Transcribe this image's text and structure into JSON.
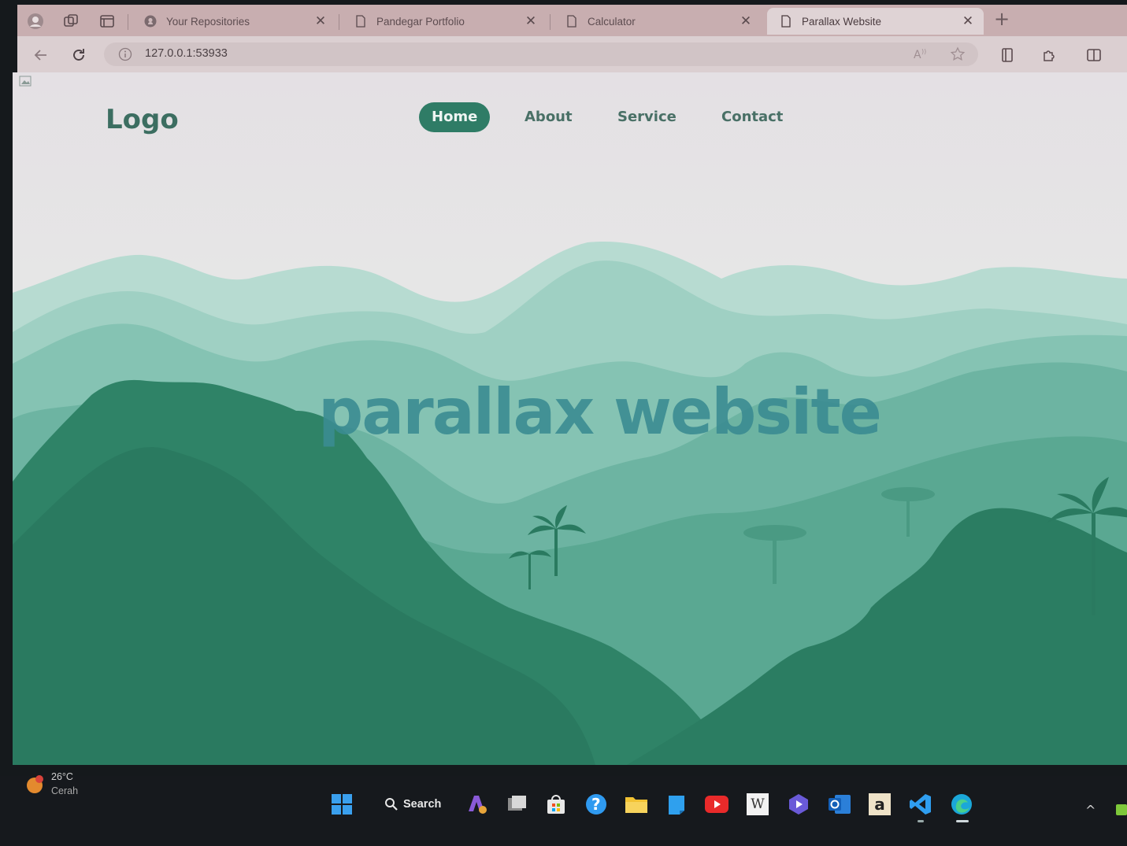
{
  "browser": {
    "tabs": [
      {
        "title": "Your Repositories",
        "icon": "github-icon",
        "active": false
      },
      {
        "title": "Pandegar Portfolio",
        "icon": "page-icon",
        "active": false
      },
      {
        "title": "Calculator",
        "icon": "page-icon",
        "active": false
      },
      {
        "title": "Parallax Website",
        "icon": "page-icon",
        "active": true
      }
    ],
    "close_glyph": "✕",
    "new_tab_glyph": "+",
    "url": "127.0.0.1:53933"
  },
  "page": {
    "logo": "Logo",
    "nav": [
      "Home",
      "About",
      "Service",
      "Contact"
    ],
    "active_nav": "Home",
    "hero_title": "parallax website",
    "colors": {
      "accent": "#2f7c66",
      "title": "#3b8c92",
      "logo": "#3c6e61"
    }
  },
  "taskbar": {
    "temperature": "26°C",
    "weather": "Cerah",
    "search_label": "Search",
    "apps": [
      "start-icon",
      "copilot-icon",
      "task-view-icon",
      "store-icon",
      "help-icon",
      "file-explorer-icon",
      "notes-icon",
      "youtube-icon",
      "wikipedia-icon",
      "media-player-icon",
      "outlook-icon",
      "amazon-icon",
      "vscode-icon",
      "edge-icon"
    ],
    "wikipedia_glyph": "W",
    "amazon_glyph": "a",
    "tray_chevron": "^"
  }
}
